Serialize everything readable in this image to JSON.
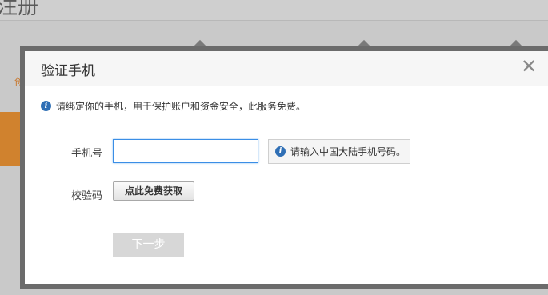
{
  "background": {
    "title": "注册",
    "side_text": "创"
  },
  "dialog": {
    "title": "验证手机",
    "close_symbol": "✕",
    "notice": "请绑定你的手机，用于保护账户和资金安全，此服务免费。",
    "info_icon_glyph": "i",
    "phone_label": "手机号",
    "phone_value": "",
    "phone_tip": "请输入中国大陆手机号码。",
    "code_label": "校验码",
    "get_code_button": "点此免费获取",
    "next_button": "下一步"
  },
  "colors": {
    "info_icon": "#2f6fb5",
    "input_focus_border": "#3a8ee6",
    "disabled_button": "#d7d7d7",
    "background_accent": "#d0822e"
  }
}
